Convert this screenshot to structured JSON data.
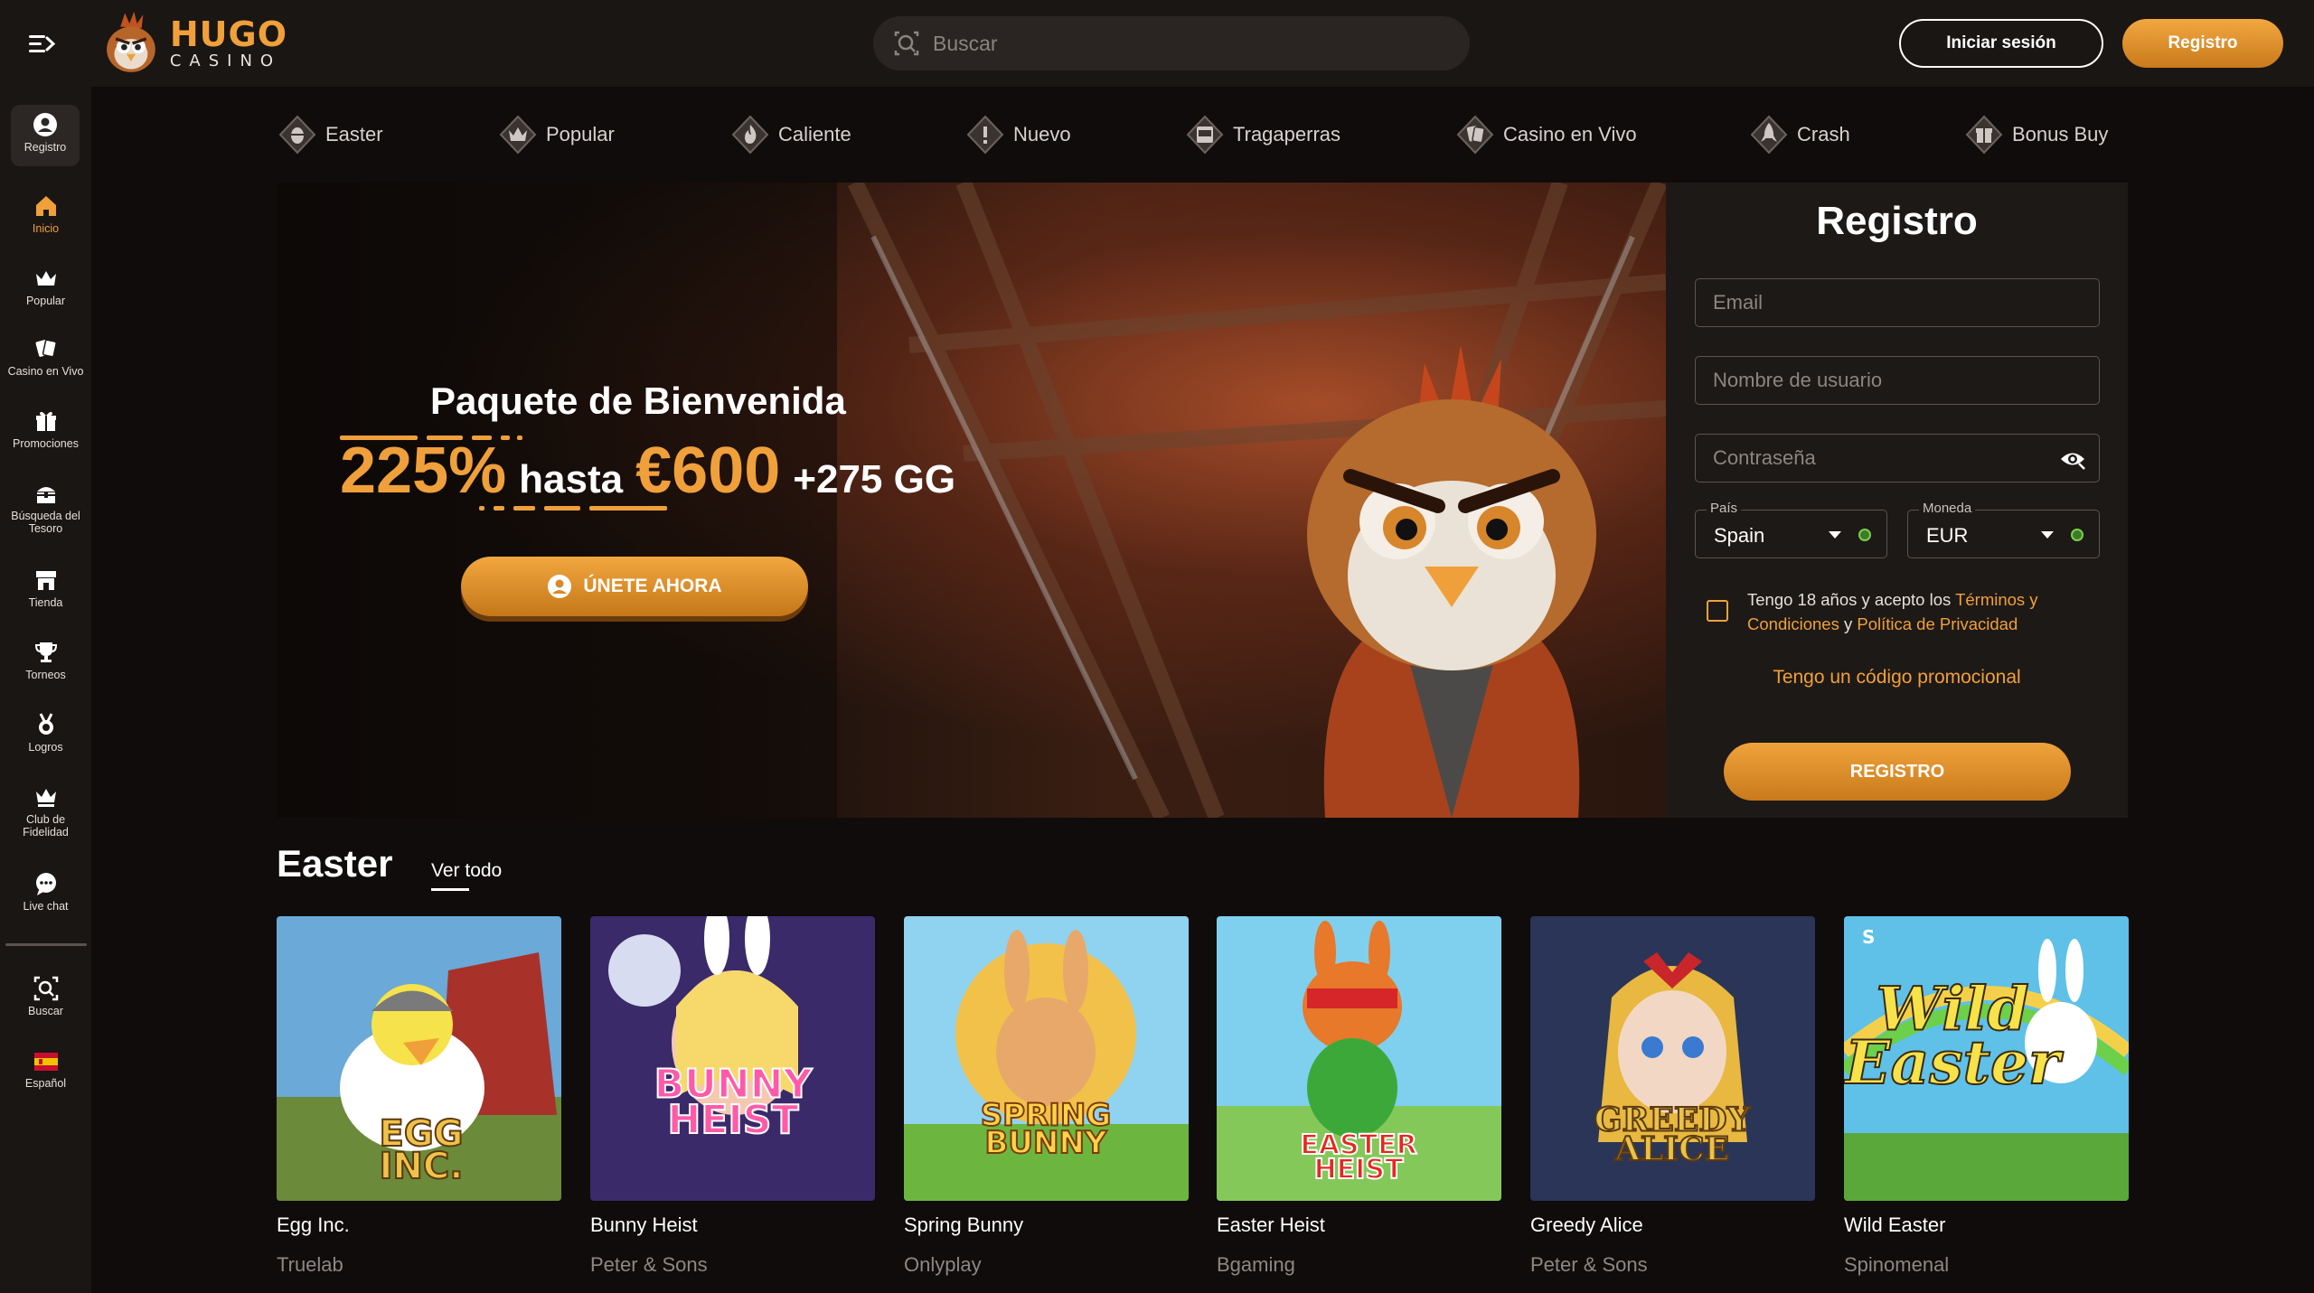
{
  "header": {
    "logo_top": "HUGO",
    "logo_bottom": "CASINO",
    "search_placeholder": "Buscar",
    "login_label": "Iniciar sesión",
    "register_label": "Registro"
  },
  "sidebar": {
    "items": [
      {
        "label": "Registro",
        "icon": "user-icon"
      },
      {
        "label": "Inicio",
        "icon": "home-icon"
      },
      {
        "label": "Popular",
        "icon": "crown-icon"
      },
      {
        "label": "Casino en Vivo",
        "icon": "cards-icon"
      },
      {
        "label": "Promociones",
        "icon": "gift-icon"
      },
      {
        "label": "Búsqueda del Tesoro",
        "icon": "treasure-icon"
      },
      {
        "label": "Tienda",
        "icon": "shop-icon"
      },
      {
        "label": "Torneos",
        "icon": "trophy-icon"
      },
      {
        "label": "Logros",
        "icon": "medal-icon"
      },
      {
        "label": "Club de Fidelidad",
        "icon": "crown-icon"
      },
      {
        "label": "Live chat",
        "icon": "chat-icon"
      },
      {
        "label": "Buscar",
        "icon": "search-icon"
      },
      {
        "label": "Español",
        "icon": "spain-flag-icon"
      }
    ]
  },
  "categories": [
    {
      "label": "Easter"
    },
    {
      "label": "Popular"
    },
    {
      "label": "Caliente"
    },
    {
      "label": "Nuevo"
    },
    {
      "label": "Tragaperras"
    },
    {
      "label": "Casino en Vivo"
    },
    {
      "label": "Crash"
    },
    {
      "label": "Bonus Buy"
    }
  ],
  "hero": {
    "title": "Paquete de Bienvenida",
    "percent": "225%",
    "hasta": "hasta",
    "amount": "€600",
    "extra": "+275 GG",
    "cta": "ÚNETE AHORA"
  },
  "register_form": {
    "title": "Registro",
    "email_placeholder": "Email",
    "username_placeholder": "Nombre de usuario",
    "password_placeholder": "Contraseña",
    "country_label": "País",
    "country_value": "Spain",
    "currency_label": "Moneda",
    "currency_value": "EUR",
    "terms_prefix": "Tengo 18 años y acepto los ",
    "terms_link": "Términos y Condiciones",
    "terms_and": " y ",
    "privacy_link": "Política de Privacidad",
    "promo_link": "Tengo un código promocional",
    "submit": "REGISTRO"
  },
  "easter": {
    "title": "Easter",
    "see_all": "Ver todo",
    "games": [
      {
        "name": "Egg Inc.",
        "provider": "Truelab",
        "art_text": "EGG INC."
      },
      {
        "name": "Bunny Heist",
        "provider": "Peter & Sons",
        "art_text": "BUNNY HEIST"
      },
      {
        "name": "Spring Bunny",
        "provider": "Onlyplay",
        "art_text": "SPRING BUNNY"
      },
      {
        "name": "Easter Heist",
        "provider": "Bgaming",
        "art_text": "EASTER HEIST"
      },
      {
        "name": "Greedy Alice",
        "provider": "Peter & Sons",
        "art_text": "GREEDY ALICE"
      },
      {
        "name": "Wild Easter",
        "provider": "Spinomenal",
        "art_text": "Wild Easter"
      }
    ]
  },
  "colors": {
    "accent": "#f0a03a",
    "background": "#0f0c0b",
    "panel": "#1a1614"
  }
}
